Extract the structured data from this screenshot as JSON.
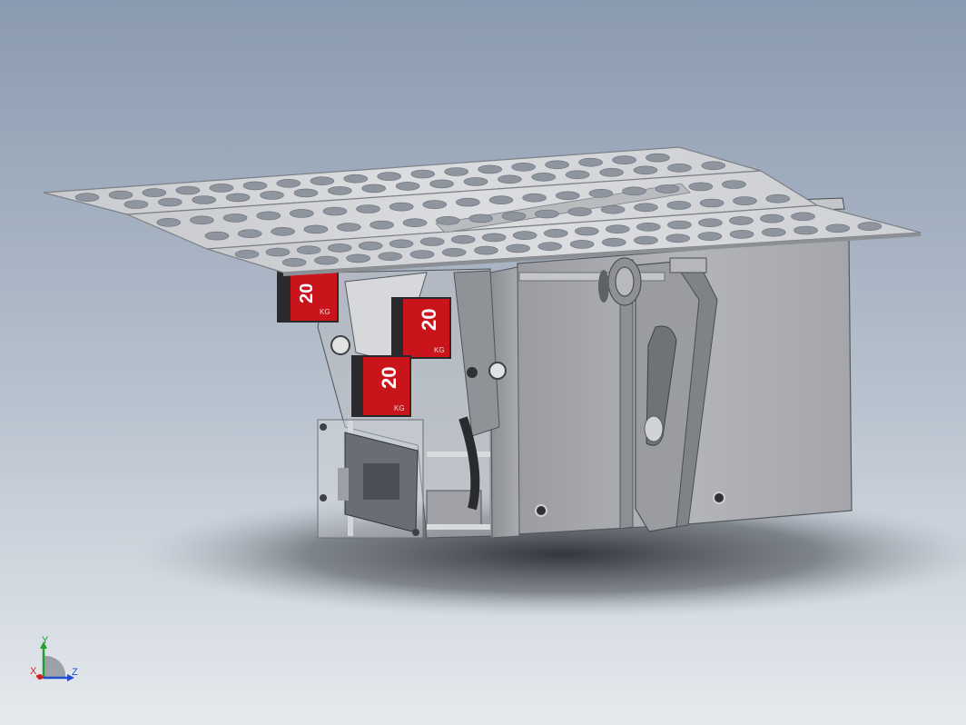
{
  "scene": {
    "colors": {
      "background_top": "#8a9ab0",
      "background_bottom": "#e6eaee",
      "plate": "#d4d5d9",
      "plate_edge": "#7d8087",
      "body": "#a7a9ae",
      "body_dark": "#7e8186",
      "servo_red": "#c8141a",
      "servo_dark": "#2a2a2c"
    },
    "servos": [
      {
        "big": "20",
        "sub": "KG"
      },
      {
        "big": "20",
        "sub": "KG"
      },
      {
        "big": "20",
        "sub": "KG"
      }
    ]
  },
  "triad": {
    "axis_y": "Y",
    "axis_x": "X",
    "axis_z": "Z"
  }
}
